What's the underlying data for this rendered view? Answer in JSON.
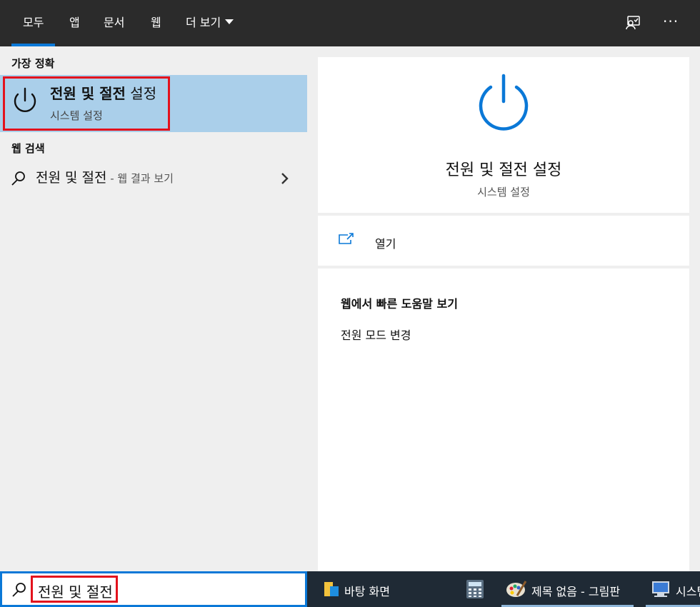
{
  "tabs": [
    {
      "label": "모두",
      "active": true
    },
    {
      "label": "앱"
    },
    {
      "label": "문서"
    },
    {
      "label": "웹"
    },
    {
      "label": "더 보기"
    }
  ],
  "top_icons": {
    "feedback": "feedback-icon",
    "more": "···"
  },
  "left": {
    "best_match_title": "가장 정확",
    "best_match": {
      "title_bold": "전원 및 절전",
      "title_rest": " 설정",
      "subtitle": "시스템 설정",
      "icon": "power-icon"
    },
    "web_search_title": "웹 검색",
    "web_search_item": {
      "query": "전원 및 절전",
      "suffix": " - 웹 결과 보기"
    }
  },
  "right": {
    "title": "전원 및 절전 설정",
    "subtitle": "시스템 설정",
    "open_label": "열기",
    "help_title": "웹에서 빠른 도움말 보기",
    "help_link": "전원 모드 변경"
  },
  "search": {
    "value": "전원 및 절전"
  },
  "taskbar": [
    {
      "label": "바탕 화면",
      "icon": "folder-icon"
    },
    {
      "label": "",
      "icon": "calculator-icon"
    },
    {
      "label": "제목 없음 - 그림판",
      "icon": "paint-icon",
      "active": true
    },
    {
      "label": "시스템",
      "icon": "system-icon",
      "active": true
    }
  ],
  "colors": {
    "accent": "#0a78d7",
    "highlight": "#e3121d",
    "selected": "#aacfea",
    "topbar": "#2b2b2b",
    "taskbar": "#1f2a35"
  }
}
